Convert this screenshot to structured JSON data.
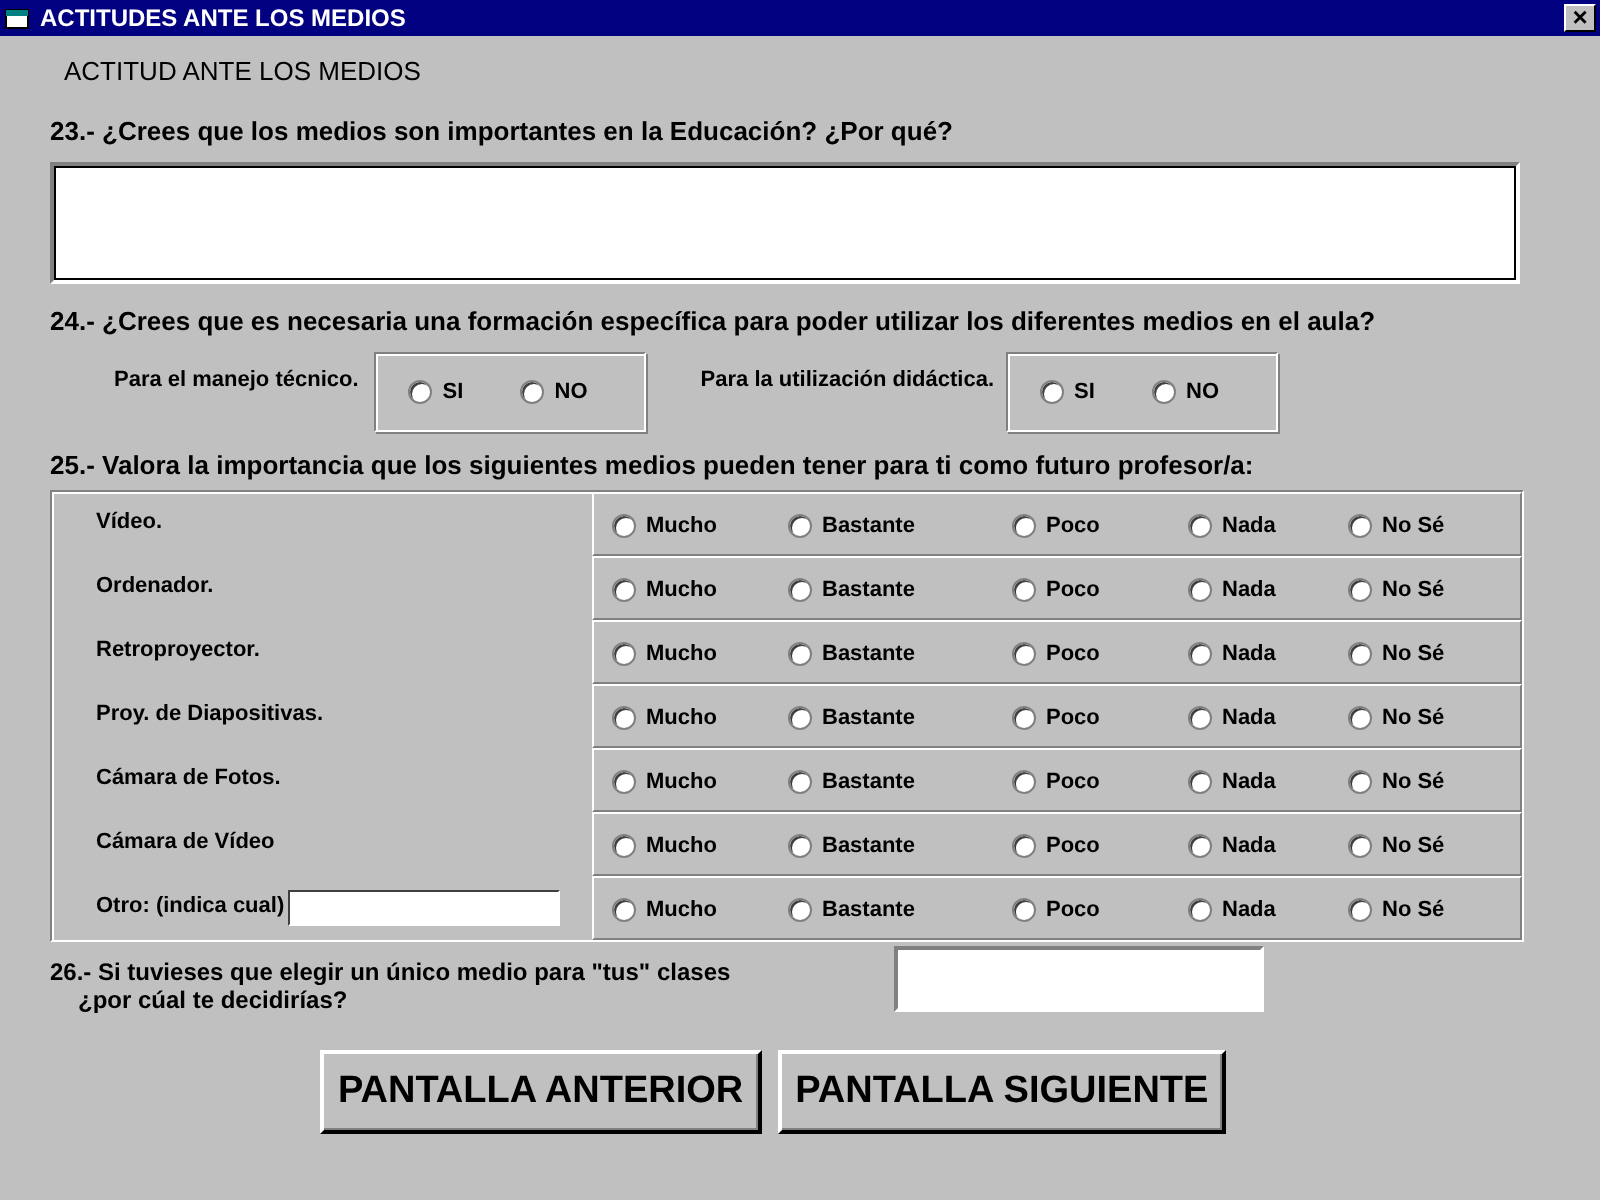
{
  "window": {
    "title": "ACTITUDES ANTE LOS MEDIOS",
    "close": "×"
  },
  "heading": "ACTITUD ANTE LOS MEDIOS",
  "q23": {
    "question": "23.- ¿Crees que los medios son importantes en la Educación? ¿Por qué?"
  },
  "q24": {
    "question": "24.- ¿Crees que es necesaria una formación específica para poder utilizar los diferentes medios en el aula?",
    "groups": [
      {
        "label": "Para el manejo técnico.",
        "options": [
          {
            "label": "SI",
            "selected": false
          },
          {
            "label": "NO",
            "selected": false
          }
        ]
      },
      {
        "label": "Para la utilización didáctica.",
        "options": [
          {
            "label": "SI",
            "selected": false
          },
          {
            "label": "NO",
            "selected": false
          }
        ]
      }
    ]
  },
  "q25": {
    "question": "25.- Valora la importancia que los siguientes medios pueden tener para ti como futuro profesor/a:",
    "rows": [
      {
        "kind": "label",
        "name": "Vídeo.",
        "options": [
          {
            "label": "Mucho",
            "selected": false
          },
          {
            "label": "Bastante",
            "selected": false
          },
          {
            "label": "Poco",
            "selected": false
          },
          {
            "label": "Nada",
            "selected": false
          },
          {
            "label": "No Sé",
            "selected": false
          }
        ]
      },
      {
        "kind": "label",
        "name": "Ordenador.",
        "options": [
          {
            "label": "Mucho",
            "selected": false
          },
          {
            "label": "Bastante",
            "selected": false
          },
          {
            "label": "Poco",
            "selected": false
          },
          {
            "label": "Nada",
            "selected": false
          },
          {
            "label": "No Sé",
            "selected": false
          }
        ]
      },
      {
        "kind": "label",
        "name": "Retroproyector.",
        "options": [
          {
            "label": "Mucho",
            "selected": false
          },
          {
            "label": "Bastante",
            "selected": false
          },
          {
            "label": "Poco",
            "selected": false
          },
          {
            "label": "Nada",
            "selected": false
          },
          {
            "label": "No Sé",
            "selected": false
          }
        ]
      },
      {
        "kind": "label",
        "name": "Proy. de Diapositivas.",
        "options": [
          {
            "label": "Mucho",
            "selected": false
          },
          {
            "label": "Bastante",
            "selected": false
          },
          {
            "label": "Poco",
            "selected": false
          },
          {
            "label": "Nada",
            "selected": false
          },
          {
            "label": "No Sé",
            "selected": false
          }
        ]
      },
      {
        "kind": "label",
        "name": "Cámara de Fotos.",
        "options": [
          {
            "label": "Mucho",
            "selected": false
          },
          {
            "label": "Bastante",
            "selected": false
          },
          {
            "label": "Poco",
            "selected": false
          },
          {
            "label": "Nada",
            "selected": false
          },
          {
            "label": "No Sé",
            "selected": false
          }
        ]
      },
      {
        "kind": "label",
        "name": "Cámara de Vídeo",
        "options": [
          {
            "label": "Mucho",
            "selected": false
          },
          {
            "label": "Bastante",
            "selected": false
          },
          {
            "label": "Poco",
            "selected": false
          },
          {
            "label": "Nada",
            "selected": false
          },
          {
            "label": "No Sé",
            "selected": false
          }
        ]
      },
      {
        "kind": "input",
        "name": "Otro: (indica cual)",
        "options": [
          {
            "label": "Mucho",
            "selected": false
          },
          {
            "label": "Bastante",
            "selected": false
          },
          {
            "label": "Poco",
            "selected": false
          },
          {
            "label": "Nada",
            "selected": false
          },
          {
            "label": "No Sé",
            "selected": false
          }
        ]
      }
    ]
  },
  "q26": {
    "question_line1": "26.- Si tuvieses que elegir un único medio para \"tus\" clases",
    "question_line2": "¿por cúal te decidirías?"
  },
  "buttons": [
    "PANTALLA ANTERIOR",
    "PANTALLA SIGUIENTE"
  ]
}
